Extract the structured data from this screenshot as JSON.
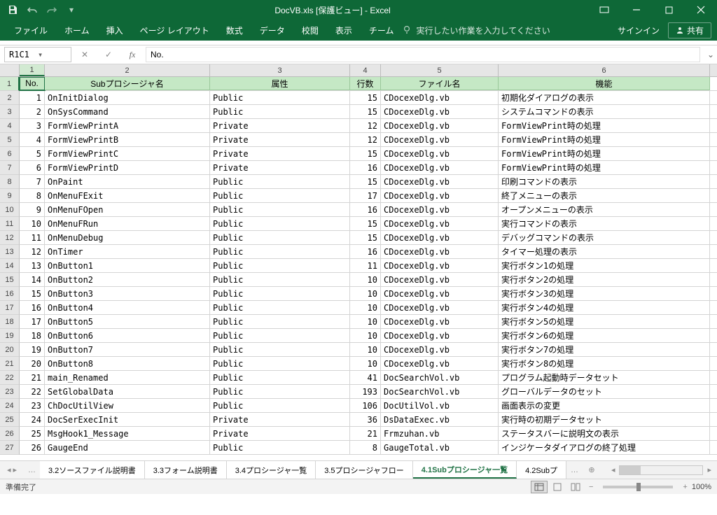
{
  "title": "DocVB.xls  [保護ビュー] - Excel",
  "qat": {
    "save": "save",
    "undo": "undo",
    "redo": "redo"
  },
  "ribbon_tabs": [
    "ファイル",
    "ホーム",
    "挿入",
    "ページ レイアウト",
    "数式",
    "データ",
    "校閲",
    "表示",
    "チーム"
  ],
  "tell_me": "実行したい作業を入力してください",
  "signin": "サインイン",
  "share": "共有",
  "name_box": "R1C1",
  "formula": "No.",
  "col_headers": [
    "1",
    "2",
    "3",
    "4",
    "5",
    "6"
  ],
  "row_headers": [
    "1",
    "2",
    "3",
    "4",
    "5",
    "6",
    "7",
    "8",
    "9",
    "10",
    "11",
    "12",
    "13",
    "14",
    "15",
    "16",
    "17",
    "18",
    "19",
    "20",
    "21",
    "22",
    "23",
    "24",
    "25",
    "26",
    "27"
  ],
  "header_row": [
    "No.",
    "Subプロシージャ名",
    "属性",
    "行数",
    "ファイル名",
    "機能"
  ],
  "rows": [
    [
      "1",
      "OnInitDialog",
      "Public",
      "15",
      "CDocexeDlg.vb",
      "初期化ダイアログの表示"
    ],
    [
      "2",
      "OnSysCommand",
      "Public",
      "15",
      "CDocexeDlg.vb",
      "システムコマンドの表示"
    ],
    [
      "3",
      "FormViewPrintA",
      "Private",
      "12",
      "CDocexeDlg.vb",
      "FormViewPrint時の処理"
    ],
    [
      "4",
      "FormViewPrintB",
      "Private",
      "12",
      "CDocexeDlg.vb",
      "FormViewPrint時の処理"
    ],
    [
      "5",
      "FormViewPrintC",
      "Private",
      "15",
      "CDocexeDlg.vb",
      "FormViewPrint時の処理"
    ],
    [
      "6",
      "FormViewPrintD",
      "Private",
      "16",
      "CDocexeDlg.vb",
      "FormViewPrint時の処理"
    ],
    [
      "7",
      "OnPaint",
      "Public",
      "15",
      "CDocexeDlg.vb",
      "印刷コマンドの表示"
    ],
    [
      "8",
      "OnMenuFExit",
      "Public",
      "17",
      "CDocexeDlg.vb",
      "終了メニューの表示"
    ],
    [
      "9",
      "OnMenuFOpen",
      "Public",
      "16",
      "CDocexeDlg.vb",
      "オープンメニューの表示"
    ],
    [
      "10",
      "OnMenuFRun",
      "Public",
      "15",
      "CDocexeDlg.vb",
      "実行コマンドの表示"
    ],
    [
      "11",
      "OnMenuDebug",
      "Public",
      "15",
      "CDocexeDlg.vb",
      "デバッグコマンドの表示"
    ],
    [
      "12",
      "OnTimer",
      "Public",
      "16",
      "CDocexeDlg.vb",
      "タイマー処理の表示"
    ],
    [
      "13",
      "OnButton1",
      "Public",
      "11",
      "CDocexeDlg.vb",
      "実行ボタン1の処理"
    ],
    [
      "14",
      "OnButton2",
      "Public",
      "10",
      "CDocexeDlg.vb",
      "実行ボタン2の処理"
    ],
    [
      "15",
      "OnButton3",
      "Public",
      "10",
      "CDocexeDlg.vb",
      "実行ボタン3の処理"
    ],
    [
      "16",
      "OnButton4",
      "Public",
      "10",
      "CDocexeDlg.vb",
      "実行ボタン4の処理"
    ],
    [
      "17",
      "OnButton5",
      "Public",
      "10",
      "CDocexeDlg.vb",
      "実行ボタン5の処理"
    ],
    [
      "18",
      "OnButton6",
      "Public",
      "10",
      "CDocexeDlg.vb",
      "実行ボタン6の処理"
    ],
    [
      "19",
      "OnButton7",
      "Public",
      "10",
      "CDocexeDlg.vb",
      "実行ボタン7の処理"
    ],
    [
      "20",
      "OnButton8",
      "Public",
      "10",
      "CDocexeDlg.vb",
      "実行ボタン8の処理"
    ],
    [
      "21",
      "main_Renamed",
      "Public",
      "41",
      "DocSearchVol.vb",
      "プログラム起動時データセット"
    ],
    [
      "22",
      "SetGlobalData",
      "Public",
      "193",
      "DocSearchVol.vb",
      "グローバルデータのセット"
    ],
    [
      "23",
      "ChDocUtilView",
      "Public",
      "106",
      "DocUtilVol.vb",
      "画面表示の変更"
    ],
    [
      "24",
      "DocSerExecInit",
      "Private",
      "36",
      "DsDataExec.vb",
      "実行時の初期データセット"
    ],
    [
      "25",
      "MsgHook1_Message",
      "Private",
      "21",
      "Frmzuhan.vb",
      "ステータスバーに説明文の表示"
    ],
    [
      "26",
      "GaugeEnd",
      "Public",
      "8",
      "GaugeTotal.vb",
      "インジケータダイアログの終了処理"
    ]
  ],
  "sheet_tabs": [
    "3.2ソースファイル説明書",
    "3.3フォーム説明書",
    "3.4プロシージャ一覧",
    "3.5プロシージャフロー",
    "4.1Subプロシージャ一覧",
    "4.2Subプ"
  ],
  "active_sheet": 4,
  "status_text": "準備完了",
  "zoom": "100%"
}
